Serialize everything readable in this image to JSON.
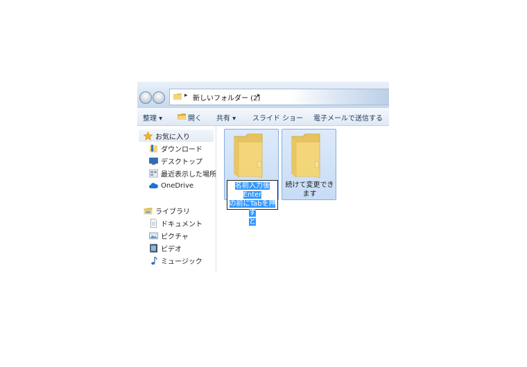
{
  "address_bar": {
    "path": "新しいフォルダー (2)"
  },
  "toolbar": {
    "organize": "整理 ▾",
    "open": "開く",
    "share": "共有 ▾",
    "slideshow": "スライド ショー",
    "email": "電子メールで送信する"
  },
  "sidebar": {
    "favorites": "お気に入り",
    "favorite_items": [
      "ダウンロード",
      "デスクトップ",
      "最近表示した場所",
      "OneDrive"
    ],
    "libraries": "ライブラリ",
    "library_items": [
      "ドキュメント",
      "ピクチャ",
      "ビデオ",
      "ミュージック"
    ]
  },
  "content": {
    "items": [
      {
        "name_lines": [
          "名前入力後Enter",
          "の前にTabを押す",
          "と"
        ],
        "state": "renaming"
      },
      {
        "name_lines": [
          "続けて変更でき",
          "ます"
        ],
        "state": "selected"
      }
    ]
  },
  "colors": {
    "selection_fill": "#c7dcf5",
    "selection_border": "#84acdd",
    "text_highlight": "#3399ff",
    "folder_yellow": "#f3d57a"
  },
  "icons": {
    "favorites": "star-icon",
    "downloads": "download-folder-icon",
    "desktop": "desktop-icon",
    "recent": "recent-places-icon",
    "onedrive": "cloud-icon",
    "libraries": "library-icon",
    "documents": "document-icon",
    "pictures": "picture-icon",
    "videos": "video-icon",
    "music": "music-note-icon"
  }
}
